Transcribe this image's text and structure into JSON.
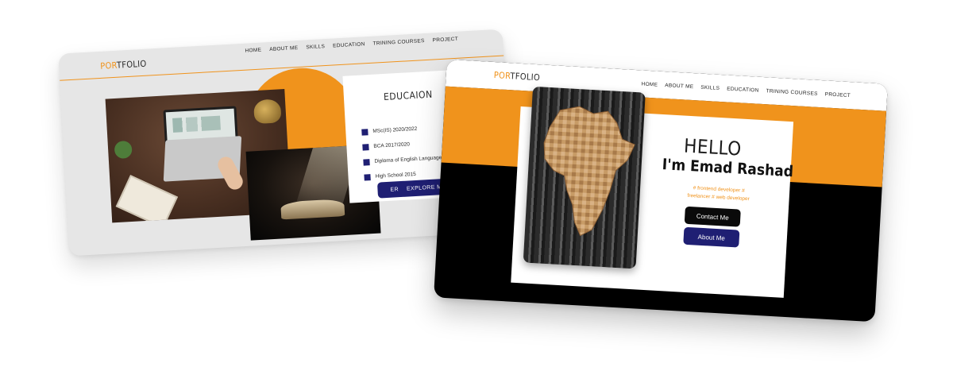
{
  "back_card": {
    "logo": {
      "highlight": "POR",
      "rest": "TFOLIO"
    },
    "nav": [
      "HOME",
      "ABOUT ME",
      "SKILLS",
      "EDUCATION",
      "TRINING COURSES",
      "PROJECT"
    ],
    "education": {
      "title": "EDUCAION",
      "items": [
        "MSc(IS) 2020/2022",
        "BCA 2017/2020",
        "Diploma of English Language",
        "High School 2015"
      ],
      "button": "EXPLORE MOR",
      "button_icon": "ER"
    }
  },
  "front_card": {
    "logo": {
      "highlight": "POR",
      "rest": "TFOLIO"
    },
    "nav": [
      "HOME",
      "ABOUT ME",
      "SKILLS",
      "EDUCATION",
      "TRINING COURSES",
      "PROJECT"
    ],
    "hero": {
      "greeting": "HELLO",
      "name": "I'm Emad Rashad",
      "tagline_line1": "# frontend developer #",
      "tagline_line2": "freelancer # web developer",
      "contact_button": "Contact Me",
      "about_button": "About Me"
    }
  },
  "colors": {
    "accent": "#f0931c",
    "navy": "#1f1f73",
    "black": "#000000"
  },
  "icons": [
    "africa-map-image",
    "laptop-desk-photo",
    "open-book-photo"
  ]
}
